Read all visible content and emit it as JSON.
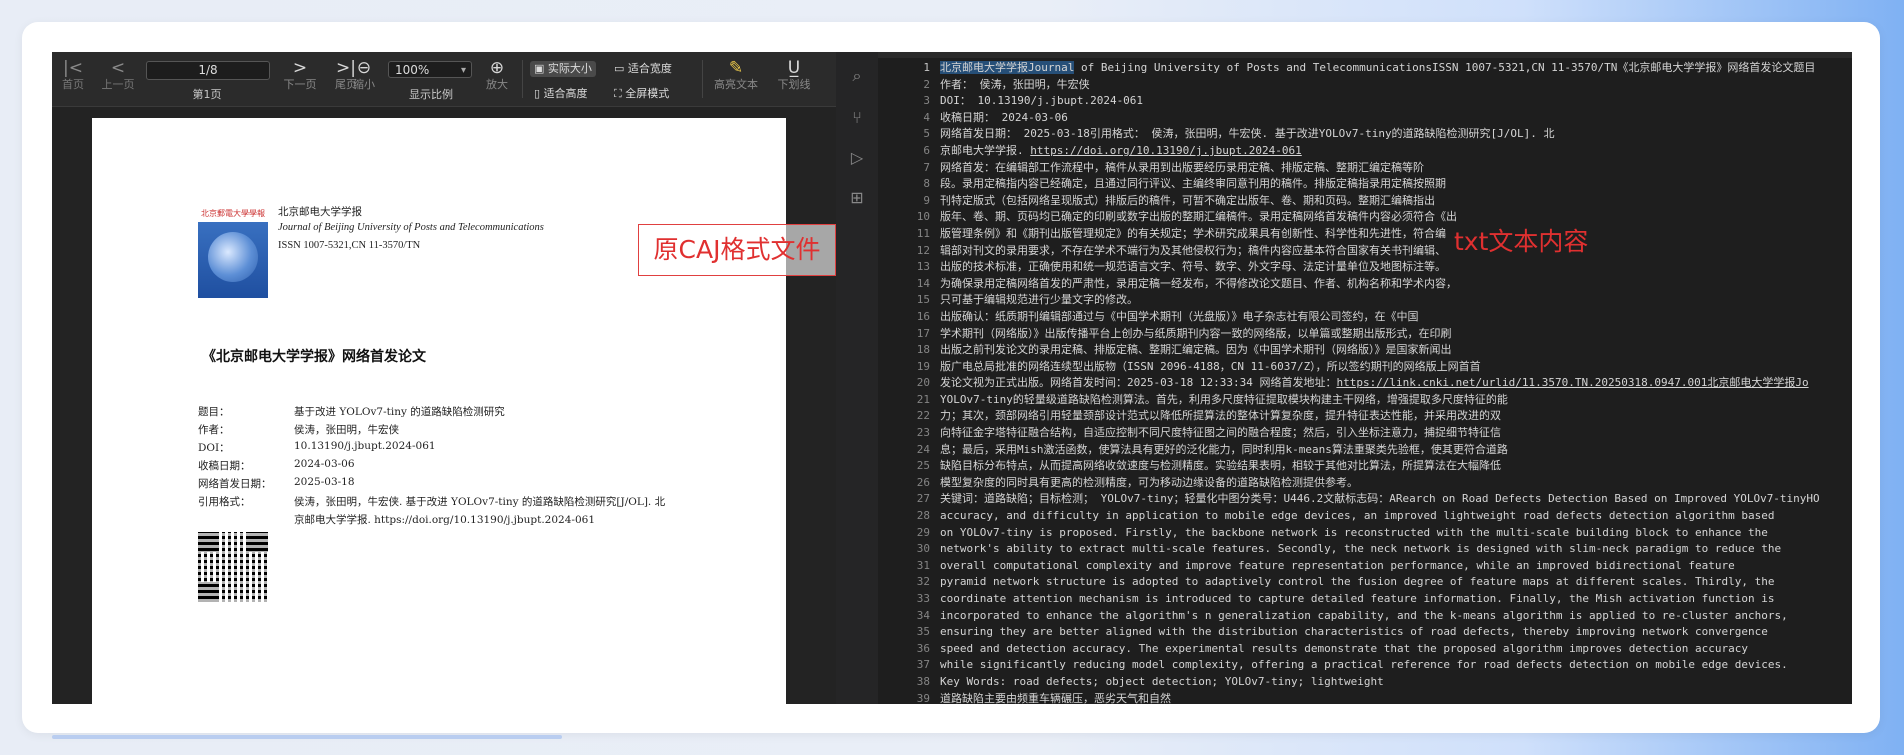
{
  "toolbar": {
    "first_page": "首页",
    "prev_page": "上一页",
    "page_box": "1/8",
    "page_label": "第1页",
    "next_page": "下一页",
    "last_page": "尾页",
    "zoom_out": "缩小",
    "zoom_value": "100%",
    "zoom_ratio_label": "显示比例",
    "zoom_in": "放大",
    "actual_size": "实际大小",
    "fit_width": "适合宽度",
    "fit_height": "适合高度",
    "fullscreen": "全屏模式",
    "highlight": "高亮文本",
    "underline": "下划线"
  },
  "document": {
    "journal_cn": "北京邮电大学学报",
    "journal_en": "Journal of Beijing University of Posts and Telecommunications",
    "issn": "ISSN 1007-5321,CN 11-3570/TN",
    "cover_title": "北京郵電大學學報",
    "heading": "《北京邮电大学学报》网络首发论文",
    "meta": [
      {
        "k": "题目：",
        "v": "基于改进 YOLOv7-tiny 的道路缺陷检测研究"
      },
      {
        "k": "作者：",
        "v": "侯涛，张田明，牛宏侠"
      },
      {
        "k": "DOI：",
        "v": "10.13190/j.jbupt.2024-061"
      },
      {
        "k": "收稿日期：",
        "v": "2024-03-06"
      },
      {
        "k": "网络首发日期：",
        "v": "2025-03-18"
      },
      {
        "k": "引用格式：",
        "v": "侯涛，张田明，牛宏侠. 基于改进 YOLOv7-tiny 的道路缺陷检测研究[J/OL]. 北"
      },
      {
        "k": "",
        "v": "京邮电大学学报. https://doi.org/10.13190/j.jbupt.2024-061"
      }
    ]
  },
  "annotations": {
    "left": "原CAJ格式文件",
    "right": "txt文本内容"
  },
  "editor": {
    "lines": [
      {
        "n": "1",
        "sel": "北京邮电大学学报Journal",
        "t": " of Beijing University of Posts and TelecommunicationsISSN 1007-5321,CN 11-3570/TN《北京邮电大学学报》网络首发论文题目"
      },
      {
        "n": "2",
        "t": "作者： 侯涛，张田明，牛宏侠"
      },
      {
        "n": "3",
        "t": "DOI： 10.13190/j.jbupt.2024-061"
      },
      {
        "n": "4",
        "t": "收稿日期： 2024-03-06"
      },
      {
        "n": "5",
        "t": "网络首发日期： 2025-03-18引用格式： 侯涛，张田明，牛宏侠. 基于改进YOLOv7-tiny的道路缺陷检测研究[J/OL]. 北"
      },
      {
        "n": "6",
        "t": "京邮电大学学报. ",
        "url": "https://doi.org/10.13190/j.jbupt.2024-061"
      },
      {
        "n": "7",
        "t": "网络首发：在编辑部工作流程中，稿件从录用到出版要经历录用定稿、排版定稿、整期汇编定稿等阶"
      },
      {
        "n": "8",
        "t": "段。录用定稿指内容已经确定，且通过同行评议、主编终审同意刊用的稿件。排版定稿指录用定稿按照期"
      },
      {
        "n": "9",
        "t": "刊特定版式（包括网络呈现版式）排版后的稿件，可暂不确定出版年、卷、期和页码。整期汇编稿指出"
      },
      {
        "n": "10",
        "t": "版年、卷、期、页码均已确定的印刷或数字出版的整期汇编稿件。录用定稿网络首发稿件内容必须符合《出"
      },
      {
        "n": "11",
        "t": "版管理条例》和《期刊出版管理规定》的有关规定；学术研究成果具有创新性、科学性和先进性，符合编"
      },
      {
        "n": "12",
        "t": "辑部对刊文的录用要求，不存在学术不端行为及其他侵权行为；稿件内容应基本符合国家有关书刊编辑、"
      },
      {
        "n": "13",
        "t": "出版的技术标准，正确使用和统一规范语言文字、符号、数字、外文字母、法定计量单位及地图标注等。"
      },
      {
        "n": "14",
        "t": "为确保录用定稿网络首发的严肃性，录用定稿一经发布，不得修改论文题目、作者、机构名称和学术内容，"
      },
      {
        "n": "15",
        "t": "只可基于编辑规范进行少量文字的修改。"
      },
      {
        "n": "16",
        "t": "出版确认：纸质期刊编辑部通过与《中国学术期刊（光盘版）》电子杂志社有限公司签约，在《中国"
      },
      {
        "n": "17",
        "t": "学术期刊（网络版）》出版传播平台上创办与纸质期刊内容一致的网络版，以单篇或整期出版形式，在印刷"
      },
      {
        "n": "18",
        "t": "出版之前刊发论文的录用定稿、排版定稿、整期汇编定稿。因为《中国学术期刊（网络版）》是国家新闻出"
      },
      {
        "n": "19",
        "t": "版广电总局批准的网络连续型出版物（ISSN 2096-4188，CN 11-6037/Z），所以签约期刊的网络版上网首首"
      },
      {
        "n": "20",
        "t": "发论文视为正式出版。网络首发时间：2025-03-18 12:33:34 网络首发地址：",
        "url": "https://link.cnki.net/urlid/11.3570.TN.20250318.0947.001北京邮电大学学报Jo"
      },
      {
        "n": "21",
        "t": "YOLOv7-tiny的轻量级道路缺陷检测算法。首先，利用多尺度特征提取模块构建主干网络，增强提取多尺度特征的能"
      },
      {
        "n": "22",
        "t": "力；其次，颈部网络引用轻量颈部设计范式以降低所提算法的整体计算复杂度，提升特征表达性能，并采用改进的双"
      },
      {
        "n": "23",
        "t": "向特征金字塔特征融合结构，自适应控制不同尺度特征图之间的融合程度；然后，引入坐标注意力，捕捉细节特征信"
      },
      {
        "n": "24",
        "t": "息；最后，采用Mish激活函数，使算法具有更好的泛化能力，同时利用k-means算法重聚类先验框，使其更符合道路"
      },
      {
        "n": "25",
        "t": "缺陷目标分布特点，从而提高网络收敛速度与检测精度。实验结果表明，相较于其他对比算法，所提算法在大幅降低"
      },
      {
        "n": "26",
        "t": "模型复杂度的同时具有更高的检测精度，可为移动边缘设备的道路缺陷检测提供参考。"
      },
      {
        "n": "27",
        "t": "关键词：道路缺陷；目标检测； YOLOv7-tiny；轻量化中图分类号：U446.2文献标志码：ARearch on Road Defects Detection Based on Improved YOLOv7-tinyHO"
      },
      {
        "n": "28",
        "t": "accuracy, and difficulty in application to mobile edge devices, an improved lightweight road defects detection algorithm based"
      },
      {
        "n": "29",
        "t": "on YOLOv7-tiny is proposed. Firstly, the backbone network is reconstructed with the multi-scale building block to enhance the"
      },
      {
        "n": "30",
        "t": "network's ability to extract multi-scale features. Secondly, the neck network is designed with slim-neck paradigm to reduce the"
      },
      {
        "n": "31",
        "t": "overall computational complexity and improve feature representation performance, while an improved bidirectional feature"
      },
      {
        "n": "32",
        "t": "pyramid network structure is adopted to adaptively control the fusion degree of feature maps at different scales. Thirdly, the"
      },
      {
        "n": "33",
        "t": "coordinate attention mechanism is introduced to capture detailed feature information. Finally, the Mish activation function is"
      },
      {
        "n": "34",
        "t": "incorporated to enhance the algorithm's n generalization capability, and the k-means algorithm is applied to re-cluster anchors,"
      },
      {
        "n": "35",
        "t": "ensuring they are better aligned with the distribution characteristics of road defects, thereby improving network convergence"
      },
      {
        "n": "36",
        "t": "speed and detection accuracy. The experimental results demonstrate that the proposed algorithm improves detection accuracy"
      },
      {
        "n": "37",
        "t": "while significantly reducing model complexity, offering a practical reference for road defects detection on mobile edge devices."
      },
      {
        "n": "38",
        "t": "Key Words: road defects; object detection; YOLOv7-tiny; lightweight"
      },
      {
        "n": "39",
        "t": "道路缺陷主要由频重车辆碾压，恶劣天气和自然"
      }
    ]
  }
}
